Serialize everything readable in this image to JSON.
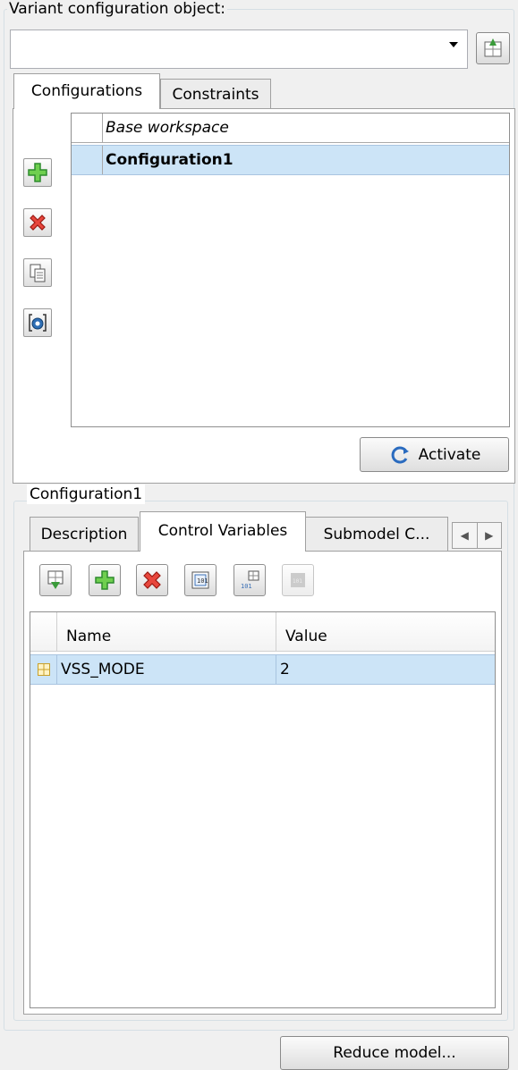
{
  "variant_object": {
    "label": "Variant configuration object:",
    "value": ""
  },
  "top_tabs": {
    "configurations": "Configurations",
    "constraints": "Constraints"
  },
  "config_table": {
    "rows": [
      {
        "name": "Base workspace",
        "style": "italic"
      },
      {
        "name": "Configuration1",
        "style": "bold",
        "selected": true
      }
    ]
  },
  "activate_label": "Activate",
  "config_details": {
    "title": "Configuration1",
    "tabs": [
      "Description",
      "Control Variables",
      "Submodel C..."
    ],
    "active_tab": "Control Variables",
    "columns": [
      "Name",
      "Value"
    ],
    "rows": [
      {
        "name": "VSS_MODE",
        "value": "2"
      }
    ]
  },
  "reduce_label": "Reduce model...",
  "colors": {
    "selection": "#cce4f7",
    "window_bg": "#f0f0f0"
  }
}
